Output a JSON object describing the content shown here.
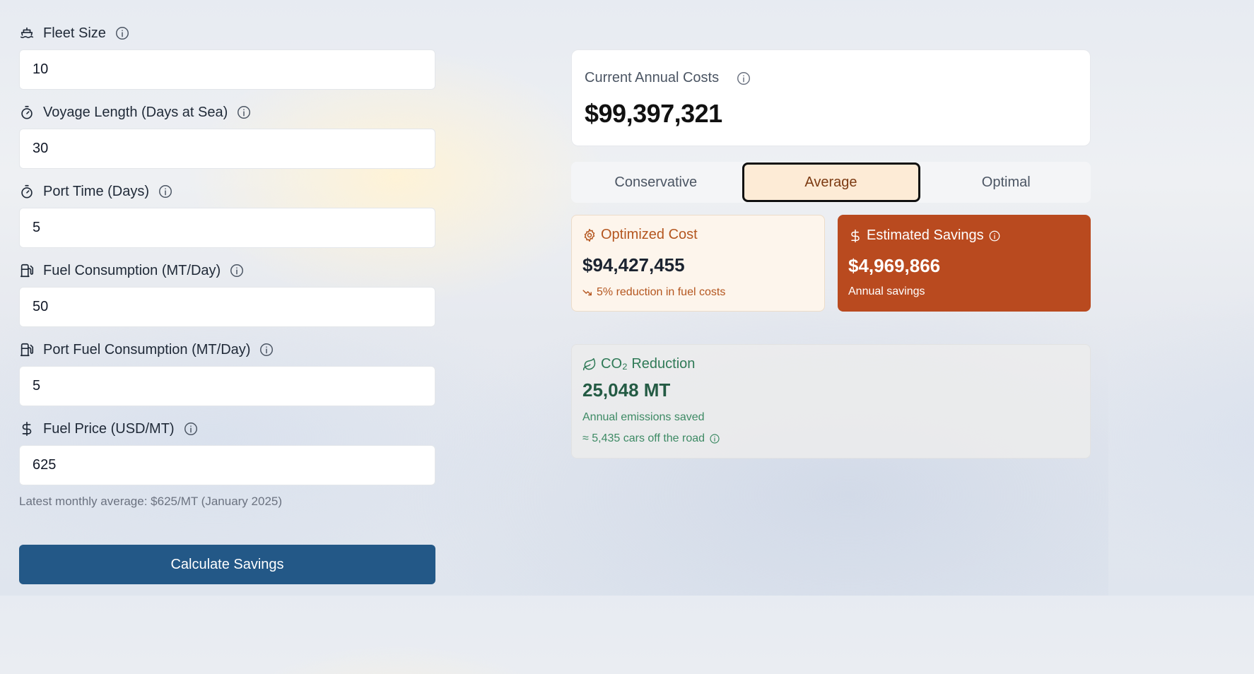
{
  "form": {
    "fields": [
      {
        "label": "Fleet Size",
        "value": "10",
        "icon": "ship-icon"
      },
      {
        "label": "Voyage Length (Days at Sea)",
        "value": "30",
        "icon": "timer-icon"
      },
      {
        "label": "Port Time (Days)",
        "value": "5",
        "icon": "timer-icon"
      },
      {
        "label": "Fuel Consumption (MT/Day)",
        "value": "50",
        "icon": "fuel-pump-icon"
      },
      {
        "label": "Port Fuel Consumption (MT/Day)",
        "value": "5",
        "icon": "fuel-pump-icon"
      },
      {
        "label": "Fuel Price (USD/MT)",
        "value": "625",
        "icon": "dollar-icon"
      }
    ],
    "hint": "Latest monthly average: $625/MT (January 2025)",
    "submit_label": "Calculate Savings"
  },
  "current": {
    "title": "Current Annual Costs",
    "value": "$99,397,321"
  },
  "scenario_tabs": {
    "items": [
      "Conservative",
      "Average",
      "Optimal"
    ],
    "selected": "Average"
  },
  "optimized": {
    "title": "Optimized Cost",
    "value": "$94,427,455",
    "note": "5% reduction in fuel costs"
  },
  "savings": {
    "title": "Estimated Savings",
    "value": "$4,969,866",
    "note": "Annual savings"
  },
  "co2": {
    "title": "CO₂ Reduction",
    "value": "25,048 MT",
    "note": "Annual emissions saved",
    "cars": "≈ 5,435 cars off the road"
  },
  "colors": {
    "primary_button": "#235887",
    "savings_card": "#b94a1f",
    "optimized_accent": "#b4561f",
    "co2_accent": "#2f7a57",
    "active_tab_bg": "#fdebd6"
  }
}
